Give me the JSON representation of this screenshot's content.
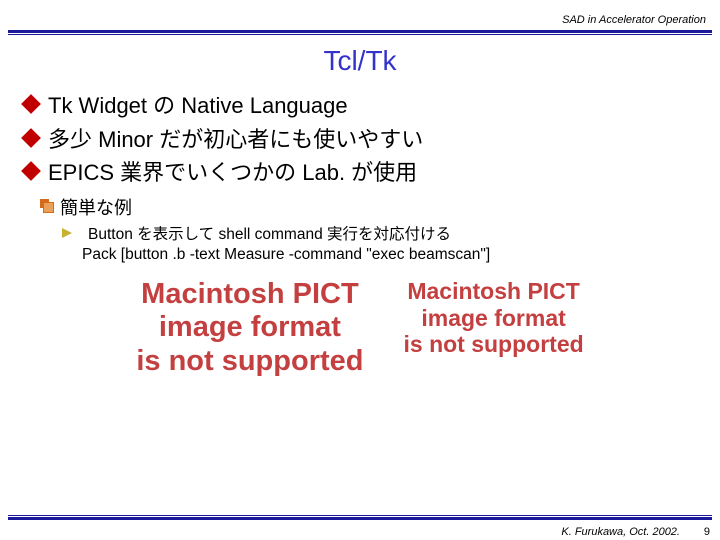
{
  "header": {
    "text": "SAD in Accelerator Operation"
  },
  "title": "Tcl/Tk",
  "bullets": [
    {
      "text": "Tk Widget の Native Language"
    },
    {
      "text": "多少 Minor だが初心者にも使いやすい"
    },
    {
      "text": "EPICS 業界でいくつかの Lab. が使用"
    }
  ],
  "sub": {
    "text": "簡単な例"
  },
  "subsub": {
    "text": "Button を表示して shell command 実行を対応付ける"
  },
  "code": "Pack [button .b -text Measure -command \"exec beamscan\"]",
  "pict": {
    "l1": "Macintosh PICT",
    "l2": "image format",
    "l3": "is not supported"
  },
  "footer": {
    "credit": "K. Furukawa, Oct. 2002.",
    "page": "9"
  }
}
